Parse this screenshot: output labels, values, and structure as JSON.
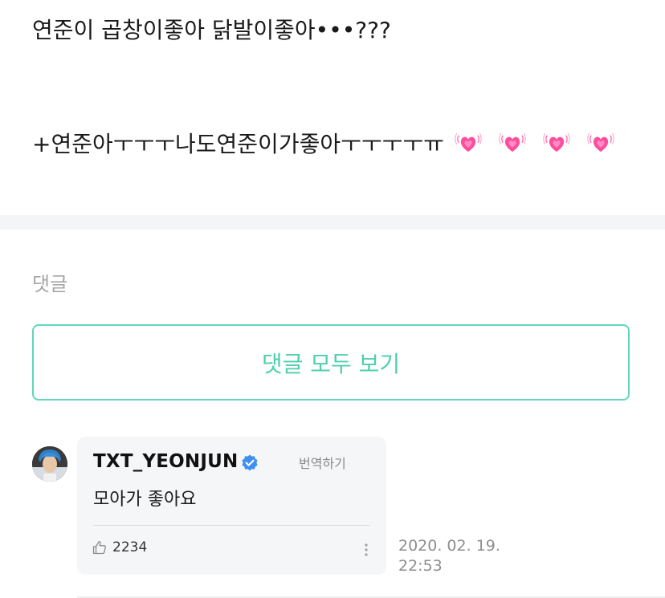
{
  "post": {
    "line1": "연준이 곱창이좋아 닭발이좋아•••???",
    "line2": "+연준아ㅜㅜㅜ나도연준이가좋아ㅜㅜㅜㅜㅠ",
    "hearts": [
      "growing-heart-emoji",
      "growing-heart-emoji",
      "growing-heart-emoji",
      "growing-heart-emoji"
    ]
  },
  "comments": {
    "heading": "댓글",
    "view_all_label": "댓글 모두 보기",
    "items": [
      {
        "author": "TXT_YEONJUN",
        "verified": true,
        "translate_label": "번역하기",
        "text": "모아가 좋아요",
        "likes": "2234",
        "date": "2020. 02. 19.",
        "time": "22:53"
      }
    ]
  },
  "colors": {
    "accent": "#4ecfad",
    "verified": "#3f8ff2",
    "heart": "#ff4d9d"
  }
}
